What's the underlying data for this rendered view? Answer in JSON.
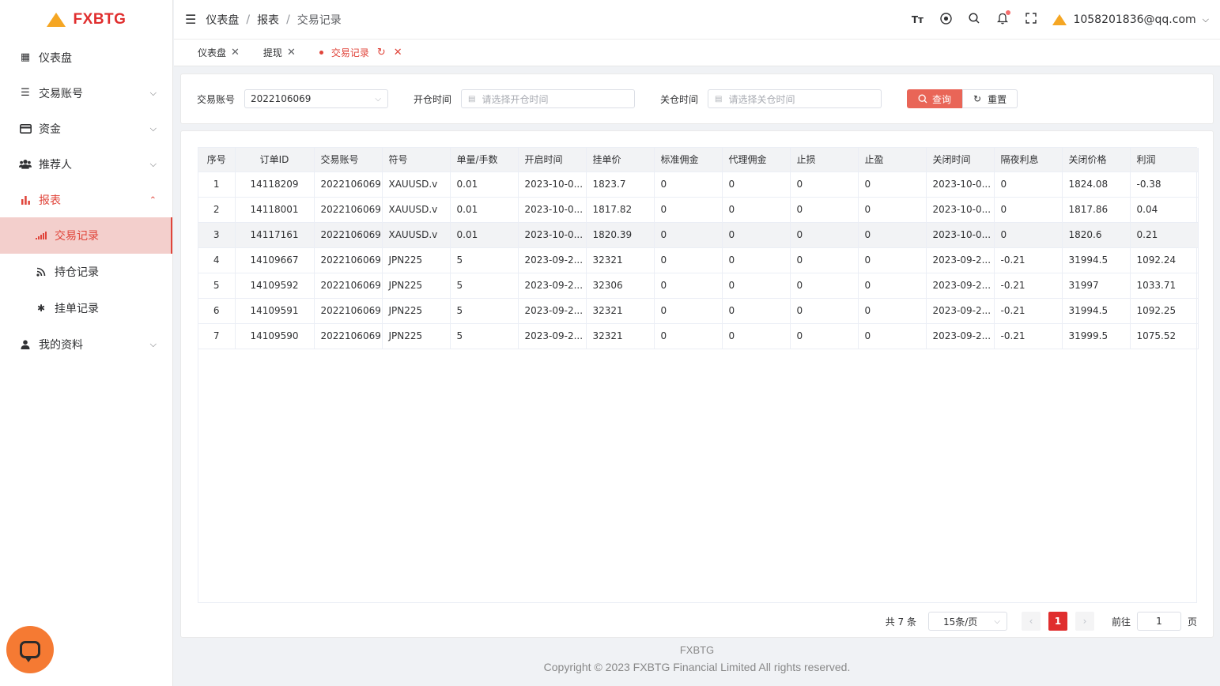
{
  "brand": {
    "name": "FXBTG"
  },
  "sidebar": {
    "items": [
      {
        "label": "仪表盘",
        "icon": "grid-icon"
      },
      {
        "label": "交易账号",
        "icon": "list-icon"
      },
      {
        "label": "资金",
        "icon": "card-icon"
      },
      {
        "label": "推荐人",
        "icon": "users-icon"
      },
      {
        "label": "报表",
        "icon": "bar-chart-icon"
      },
      {
        "label": "我的资料",
        "icon": "user-icon"
      }
    ],
    "sub_items": [
      {
        "label": "交易记录",
        "icon": "signal-icon"
      },
      {
        "label": "持仓记录",
        "icon": "rss-icon"
      },
      {
        "label": "挂单记录",
        "icon": "gear-icon"
      }
    ]
  },
  "header": {
    "breadcrumb": [
      "仪表盘",
      "报表",
      "交易记录"
    ],
    "separator": "/",
    "user_email": "1058201836@qq.com"
  },
  "tabs": [
    {
      "label": "仪表盘"
    },
    {
      "label": "提现"
    },
    {
      "label": "交易记录"
    }
  ],
  "filter": {
    "account_label": "交易账号",
    "account_value": "2022106069",
    "open_label": "开仓时间",
    "open_placeholder": "请选择开仓时间",
    "close_label": "关仓时间",
    "close_placeholder": "请选择关仓时间",
    "query_label": "查询",
    "reset_label": "重置"
  },
  "table": {
    "headers": [
      "序号",
      "订单ID",
      "交易账号",
      "符号",
      "单量/手数",
      "开启时间",
      "挂单价",
      "标准佣金",
      "代理佣金",
      "止损",
      "止盈",
      "关闭时间",
      "隔夜利息",
      "关闭价格",
      "利润"
    ],
    "rows": [
      [
        "1",
        "14118209",
        "2022106069",
        "XAUUSD.v",
        "0.01",
        "2023-10-0...",
        "1823.7",
        "0",
        "0",
        "0",
        "0",
        "2023-10-0...",
        "0",
        "1824.08",
        "-0.38"
      ],
      [
        "2",
        "14118001",
        "2022106069",
        "XAUUSD.v",
        "0.01",
        "2023-10-0...",
        "1817.82",
        "0",
        "0",
        "0",
        "0",
        "2023-10-0...",
        "0",
        "1817.86",
        "0.04"
      ],
      [
        "3",
        "14117161",
        "2022106069",
        "XAUUSD.v",
        "0.01",
        "2023-10-0...",
        "1820.39",
        "0",
        "0",
        "0",
        "0",
        "2023-10-0...",
        "0",
        "1820.6",
        "0.21"
      ],
      [
        "4",
        "14109667",
        "2022106069",
        "JPN225",
        "5",
        "2023-09-2...",
        "32321",
        "0",
        "0",
        "0",
        "0",
        "2023-09-2...",
        "-0.21",
        "31994.5",
        "1092.24"
      ],
      [
        "5",
        "14109592",
        "2022106069",
        "JPN225",
        "5",
        "2023-09-2...",
        "32306",
        "0",
        "0",
        "0",
        "0",
        "2023-09-2...",
        "-0.21",
        "31997",
        "1033.71"
      ],
      [
        "6",
        "14109591",
        "2022106069",
        "JPN225",
        "5",
        "2023-09-2...",
        "32321",
        "0",
        "0",
        "0",
        "0",
        "2023-09-2...",
        "-0.21",
        "31994.5",
        "1092.25"
      ],
      [
        "7",
        "14109590",
        "2022106069",
        "JPN225",
        "5",
        "2023-09-2...",
        "32321",
        "0",
        "0",
        "0",
        "0",
        "2023-09-2...",
        "-0.21",
        "31999.5",
        "1075.52"
      ]
    ]
  },
  "pagination": {
    "total_text": "共 7 条",
    "page_size": "15条/页",
    "current_page": "1",
    "goto_label": "前往",
    "goto_value": "1",
    "page_suffix": "页"
  },
  "footer": {
    "brand": "FXBTG",
    "copyright": "Copyright © 2023 FXBTG Financial Limited All rights reserved."
  },
  "colors": {
    "accent": "#e0443a",
    "brand_red": "#e02e2e",
    "logo_orange": "#f5a623",
    "chat_orange": "#f57a33"
  }
}
